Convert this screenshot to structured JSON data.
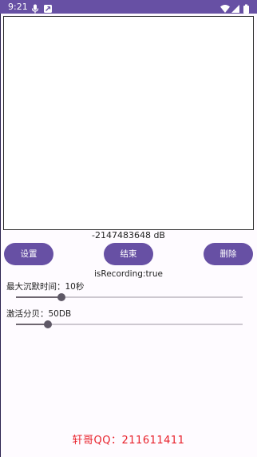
{
  "status_bar": {
    "time": "9:21",
    "icons_left": [
      "microphone-icon",
      "notification-icon"
    ],
    "icons_right": [
      "wifi-icon",
      "signal-icon",
      "battery-icon"
    ],
    "color": "#6750a4"
  },
  "meter": {
    "db_text": "-2147483648 dB"
  },
  "buttons": {
    "settings": "设置",
    "stop": "结束",
    "delete": "删除"
  },
  "status": {
    "recording_text": "isRecording:true"
  },
  "sliders": {
    "silence": {
      "label": "最大沉默时间：10秒",
      "fraction": 0.2
    },
    "activation": {
      "label": "激活分贝：50DB",
      "fraction": 0.14
    }
  },
  "footer": {
    "text": "轩哥QQ：211611411",
    "color": "#e8202a"
  }
}
